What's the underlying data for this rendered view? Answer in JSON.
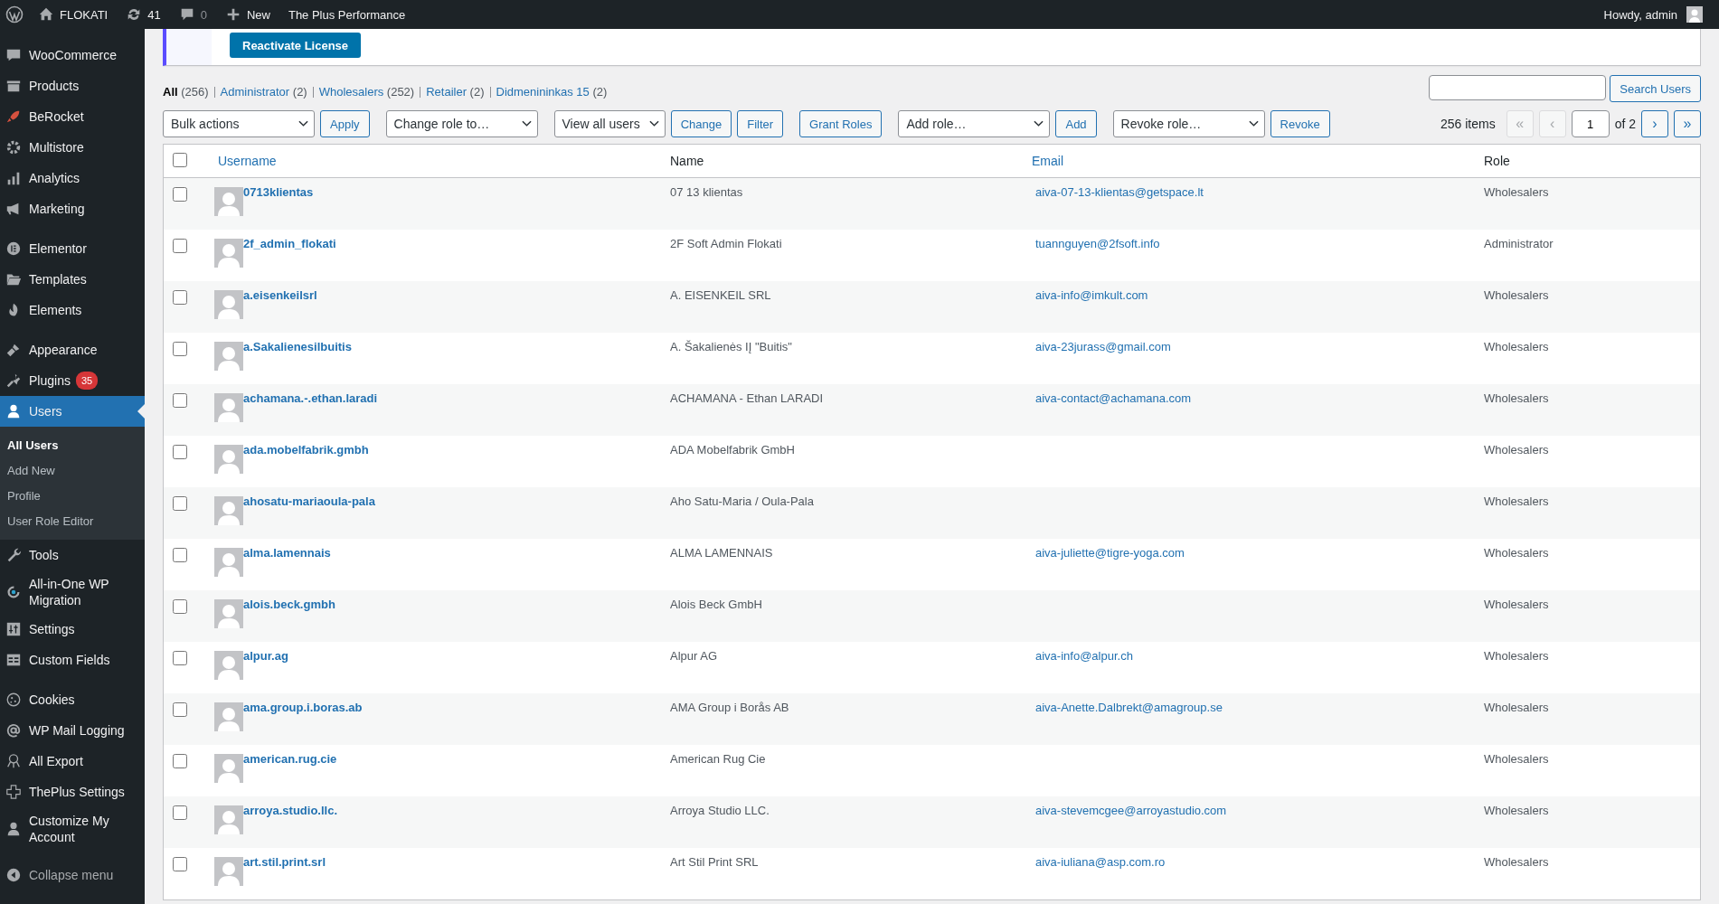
{
  "admin_bar": {
    "site": "FLOKATI",
    "updates": "41",
    "comments": "0",
    "new": "New",
    "extra": "The Plus Performance",
    "greeting": "Howdy, admin"
  },
  "sidebar": {
    "groups": [
      [
        {
          "label": "WooCommerce",
          "selected": false
        },
        {
          "label": "Products",
          "selected": false
        },
        {
          "label": "BeRocket",
          "selected": false
        },
        {
          "label": "Multistore",
          "selected": false
        },
        {
          "label": "Analytics",
          "selected": false
        },
        {
          "label": "Marketing",
          "selected": false
        }
      ],
      [
        {
          "label": "Elementor",
          "selected": false
        },
        {
          "label": "Templates",
          "selected": false
        },
        {
          "label": "Elements",
          "selected": false
        }
      ],
      [
        {
          "label": "Appearance",
          "selected": false
        },
        {
          "label": "Plugins",
          "selected": false,
          "badge": "35"
        },
        {
          "label": "Users",
          "selected": true,
          "submenu": [
            {
              "label": "All Users",
              "selected": true
            },
            {
              "label": "Add New",
              "selected": false
            },
            {
              "label": "Profile",
              "selected": false
            },
            {
              "label": "User Role Editor",
              "selected": false
            }
          ]
        },
        {
          "label": "Tools",
          "selected": false
        },
        {
          "label": "All-in-One WP Migration",
          "selected": false
        },
        {
          "label": "Settings",
          "selected": false
        },
        {
          "label": "Custom Fields",
          "selected": false
        }
      ],
      [
        {
          "label": "Cookies",
          "selected": false
        },
        {
          "label": "WP Mail Logging",
          "selected": false
        },
        {
          "label": "All Export",
          "selected": false
        },
        {
          "label": "ThePlus Settings",
          "selected": false
        },
        {
          "label": "Customize My Account",
          "selected": false
        }
      ]
    ],
    "collapse": "Collapse menu"
  },
  "notice": {
    "button": "Reactivate License"
  },
  "filters": [
    {
      "label": "All",
      "count": "(256)",
      "selected": true
    },
    {
      "label": "Administrator",
      "count": "(2)",
      "selected": false
    },
    {
      "label": "Wholesalers",
      "count": "(252)",
      "selected": false
    },
    {
      "label": "Retailer",
      "count": "(2)",
      "selected": false
    },
    {
      "label": "Didmenininkas 15",
      "count": "(2)",
      "selected": false
    }
  ],
  "search": {
    "button": "Search Users"
  },
  "toolbar": [
    {
      "kind": "select",
      "label": "Bulk actions"
    },
    {
      "kind": "button",
      "label": "Apply"
    },
    {
      "kind": "select",
      "label": "Change role to…"
    },
    {
      "kind": "select",
      "label": "View all users"
    },
    {
      "kind": "button",
      "label": "Change"
    },
    {
      "kind": "button",
      "label": "Filter"
    },
    {
      "kind": "button",
      "label": "Grant Roles"
    },
    {
      "kind": "select",
      "label": "Add role…"
    },
    {
      "kind": "button",
      "label": "Add"
    },
    {
      "kind": "select",
      "label": "Revoke role…"
    },
    {
      "kind": "button",
      "label": "Revoke"
    }
  ],
  "pagination": {
    "items": "256 items",
    "page": "1",
    "of": "of 2",
    "buttons": [
      {
        "label": "«",
        "disabled": true
      },
      {
        "label": "‹",
        "disabled": true
      },
      {
        "label": "›",
        "disabled": false
      },
      {
        "label": "»",
        "disabled": false
      }
    ]
  },
  "table": {
    "select_all_checked": false,
    "columns": [
      {
        "label": "Username",
        "sortable": true
      },
      {
        "label": "Name",
        "sortable": false
      },
      {
        "label": "Email",
        "sortable": true
      },
      {
        "label": "Role",
        "sortable": false
      }
    ],
    "rows": [
      {
        "checked": false,
        "username": "0713klientas",
        "name": "07 13 klientas",
        "email": "aiva-07-13-klientas@getspace.lt",
        "role": "Wholesalers"
      },
      {
        "checked": false,
        "username": "2f_admin_flokati",
        "name": "2F Soft Admin Flokati",
        "email": "tuannguyen@2fsoft.info",
        "role": "Administrator"
      },
      {
        "checked": false,
        "username": "a.eisenkeilsrl",
        "name": "A. EISENKEIL SRL",
        "email": "aiva-info@imkult.com",
        "role": "Wholesalers"
      },
      {
        "checked": false,
        "username": "a.Sakalienesilbuitis",
        "name": "A. Šakalienės IĮ \"Buitis\"",
        "email": "aiva-23jurass@gmail.com",
        "role": "Wholesalers"
      },
      {
        "checked": false,
        "username": "achamana.-.ethan.laradi",
        "name": "ACHAMANA - Ethan LARADI",
        "email": "aiva-contact@achamana.com",
        "role": "Wholesalers"
      },
      {
        "checked": false,
        "username": "ada.mobelfabrik.gmbh",
        "name": "ADA Mobelfabrik GmbH",
        "role": "Wholesalers"
      },
      {
        "checked": false,
        "username": "ahosatu-mariaoula-pala",
        "name": "Aho Satu-Maria / Oula-Pala",
        "role": "Wholesalers"
      },
      {
        "checked": false,
        "username": "alma.lamennais",
        "name": "ALMA LAMENNAIS",
        "email": "aiva-juliette@tigre-yoga.com",
        "role": "Wholesalers"
      },
      {
        "checked": false,
        "username": "alois.beck.gmbh",
        "name": "Alois Beck GmbH",
        "role": "Wholesalers"
      },
      {
        "checked": false,
        "username": "alpur.ag",
        "name": "Alpur AG",
        "email": "aiva-info@alpur.ch",
        "role": "Wholesalers"
      },
      {
        "checked": false,
        "username": "ama.group.i.boras.ab",
        "name": "AMA Group i Borås AB",
        "email": "aiva-Anette.Dalbrekt@amagroup.se",
        "role": "Wholesalers"
      },
      {
        "checked": false,
        "username": "american.rug.cie",
        "name": "American Rug Cie",
        "role": "Wholesalers"
      },
      {
        "checked": false,
        "username": "arroya.studio.llc.",
        "name": "Arroya Studio LLC.",
        "email": "aiva-stevemcgee@arroyastudio.com",
        "role": "Wholesalers"
      },
      {
        "checked": false,
        "username": "art.stil.print.srl",
        "name": "Art Stil Print SRL",
        "email": "aiva-iuliana@asp.com.ro",
        "role": "Wholesalers"
      }
    ]
  }
}
